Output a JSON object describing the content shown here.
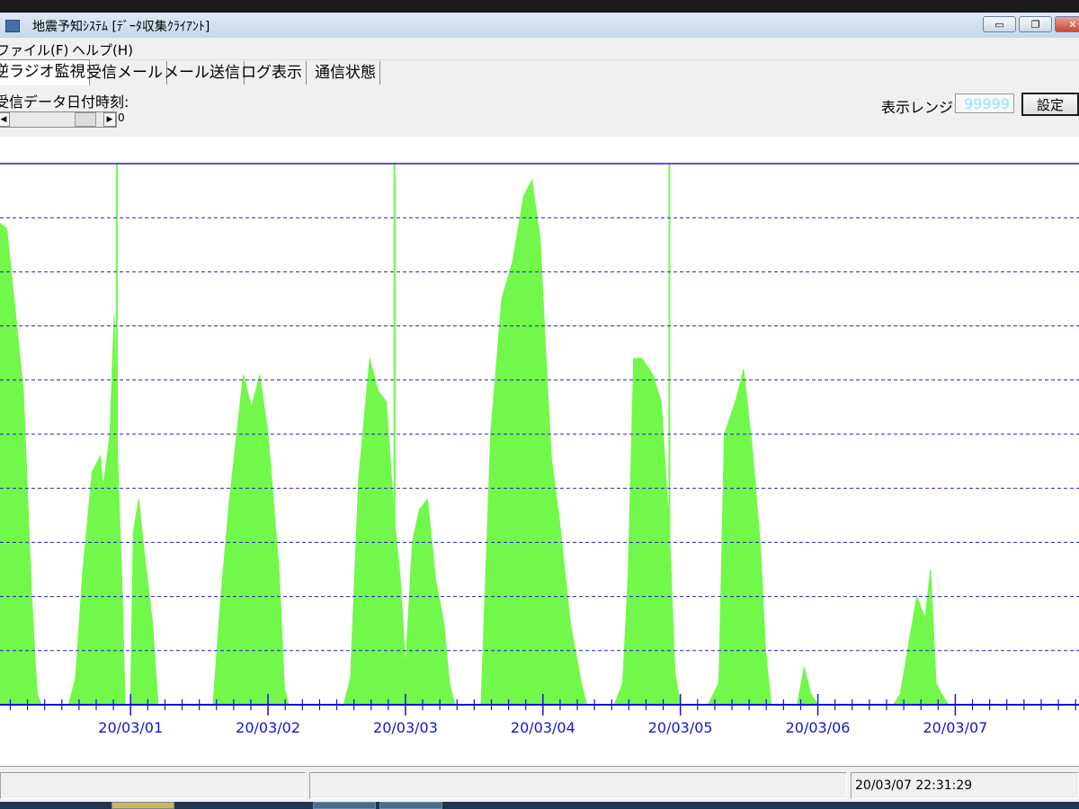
{
  "window": {
    "title": "地震予知ｼｽﾃﾑ [ﾃﾞｰﾀ収集ｸﾗｲｱﾝﾄ]",
    "minimize_glyph": "▭",
    "maximize_glyph": "❐",
    "close_glyph": "✕"
  },
  "menu": {
    "file": "ファイル(F)",
    "help": "ヘルプ(H)"
  },
  "tabs": [
    "逆ラジオ監視",
    "受信メール",
    "メール送信",
    "ログ表示",
    "通信状態"
  ],
  "controls": {
    "recv_label": "受信データ日付時刻:",
    "scroll_value": "0",
    "range_label": "表示レンジ:",
    "range_value": "99999",
    "set_button": "設定"
  },
  "status": {
    "datetime": "20/03/07 22:31:29"
  },
  "colors": {
    "fill": "#72f84a",
    "grid": "#2121c8",
    "axis": "#1414d2",
    "label": "#1414d2"
  },
  "chart_data": {
    "type": "area",
    "x_labels": [
      "20/03/01",
      "20/03/02",
      "20/03/03",
      "20/03/04",
      "20/03/05",
      "20/03/06",
      "20/03/07"
    ],
    "x_range": [
      0.05,
      7.9
    ],
    "y_range": [
      0,
      10
    ],
    "grid": "dashed horizontal",
    "series": [
      {
        "points": [
          [
            0.05,
            8.9
          ],
          [
            0.1,
            8.8
          ],
          [
            0.18,
            6.8
          ],
          [
            0.22,
            5.8
          ],
          [
            0.28,
            2.0
          ],
          [
            0.32,
            0.2
          ],
          [
            0.35,
            0
          ],
          [
            0.55,
            0
          ],
          [
            0.6,
            0.5
          ],
          [
            0.65,
            2.4
          ],
          [
            0.72,
            4.3
          ],
          [
            0.78,
            4.6
          ],
          [
            0.8,
            4.0
          ],
          [
            0.85,
            5.0
          ],
          [
            0.88,
            7.2
          ],
          [
            0.91,
            4.2
          ],
          [
            0.94,
            2.0
          ],
          [
            0.96,
            0
          ],
          [
            1.0,
            0
          ],
          [
            1.02,
            3.2
          ],
          [
            1.06,
            3.8
          ],
          [
            1.1,
            2.8
          ],
          [
            1.16,
            1.5
          ],
          [
            1.2,
            0
          ],
          [
            1.6,
            0
          ],
          [
            1.66,
            2.1
          ],
          [
            1.72,
            3.8
          ],
          [
            1.82,
            6.1
          ],
          [
            1.88,
            5.5
          ],
          [
            1.94,
            6.1
          ],
          [
            2.0,
            5.0
          ],
          [
            2.08,
            2.5
          ],
          [
            2.12,
            0.3
          ],
          [
            2.15,
            0
          ],
          [
            2.55,
            0
          ],
          [
            2.6,
            0.5
          ],
          [
            2.66,
            4.2
          ],
          [
            2.74,
            6.4
          ],
          [
            2.8,
            5.8
          ],
          [
            2.86,
            5.6
          ],
          [
            2.92,
            3.4
          ],
          [
            2.96,
            2.4
          ],
          [
            3.0,
            0.7
          ],
          [
            3.05,
            3.0
          ],
          [
            3.1,
            3.6
          ],
          [
            3.16,
            3.8
          ],
          [
            3.22,
            2.3
          ],
          [
            3.28,
            1.5
          ],
          [
            3.32,
            0.4
          ],
          [
            3.36,
            0
          ],
          [
            3.55,
            0
          ],
          [
            3.62,
            5.0
          ],
          [
            3.7,
            7.5
          ],
          [
            3.78,
            8.2
          ],
          [
            3.86,
            9.4
          ],
          [
            3.92,
            9.7
          ],
          [
            3.98,
            8.6
          ],
          [
            4.02,
            6.5
          ],
          [
            4.06,
            4.6
          ],
          [
            4.12,
            3.4
          ],
          [
            4.2,
            1.5
          ],
          [
            4.28,
            0.4
          ],
          [
            4.32,
            0
          ],
          [
            4.52,
            0
          ],
          [
            4.58,
            0.4
          ],
          [
            4.62,
            2.4
          ],
          [
            4.66,
            6.4
          ],
          [
            4.72,
            6.4
          ],
          [
            4.8,
            6.1
          ],
          [
            4.86,
            5.6
          ],
          [
            4.92,
            3.2
          ],
          [
            4.96,
            0.6
          ],
          [
            5.0,
            0
          ],
          [
            5.2,
            0
          ],
          [
            5.28,
            0.4
          ],
          [
            5.32,
            5.0
          ],
          [
            5.4,
            5.6
          ],
          [
            5.46,
            6.2
          ],
          [
            5.52,
            4.8
          ],
          [
            5.58,
            3.0
          ],
          [
            5.62,
            1.0
          ],
          [
            5.66,
            0
          ],
          [
            5.85,
            0
          ],
          [
            5.9,
            0.7
          ],
          [
            5.95,
            0.2
          ],
          [
            6.0,
            0
          ],
          [
            6.55,
            0
          ],
          [
            6.6,
            0.2
          ],
          [
            6.66,
            1.1
          ],
          [
            6.72,
            2.0
          ],
          [
            6.78,
            1.6
          ],
          [
            6.82,
            2.5
          ],
          [
            6.86,
            0.4
          ],
          [
            6.9,
            0.2
          ],
          [
            6.95,
            0
          ]
        ]
      }
    ],
    "spikes": [
      [
        0.9,
        10
      ],
      [
        2.92,
        10
      ],
      [
        4.92,
        10
      ]
    ]
  }
}
